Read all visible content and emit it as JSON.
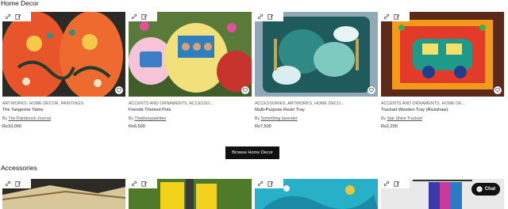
{
  "sections": [
    {
      "title": "Home Decor",
      "browse_label": "Browse Home Decor",
      "products": [
        {
          "categories": "ARTWORKS, HOME DECOR, PAINTINGS",
          "name": "The Tangerine Twins",
          "by_prefix": "By",
          "seller": "The Paintbrush Journal",
          "price": "Rs10,000"
        },
        {
          "categories": "ACCENTS AND ORNAMENTS, ACCESSO...",
          "name": "Friends Themed Pots",
          "by_prefix": "By",
          "seller": "Theblueypalettee",
          "price": "Rs6,500"
        },
        {
          "categories": "ACCESSORIES, ARTWORKS, HOME DECO...",
          "name": "Multi-Purpose Resin Tray",
          "by_prefix": "By",
          "seller": "Something lavender",
          "price": "Rs7,500"
        },
        {
          "categories": "ACCENTS AND ORNAMENTS, HOME DE...",
          "name": "Truckart Wooden Tray (Rickshaw)",
          "by_prefix": "By",
          "seller": "Star Shine Truckart",
          "price": "Rs2,200"
        }
      ]
    },
    {
      "title": "Accessories"
    }
  ],
  "chat": {
    "label": "Chat"
  },
  "icons": {
    "link": "link-icon",
    "edit": "edit-icon",
    "wishlist": "heart-icon",
    "chat": "messenger-icon"
  },
  "colors": {
    "button_bg": "#111111",
    "button_text": "#ffffff"
  }
}
